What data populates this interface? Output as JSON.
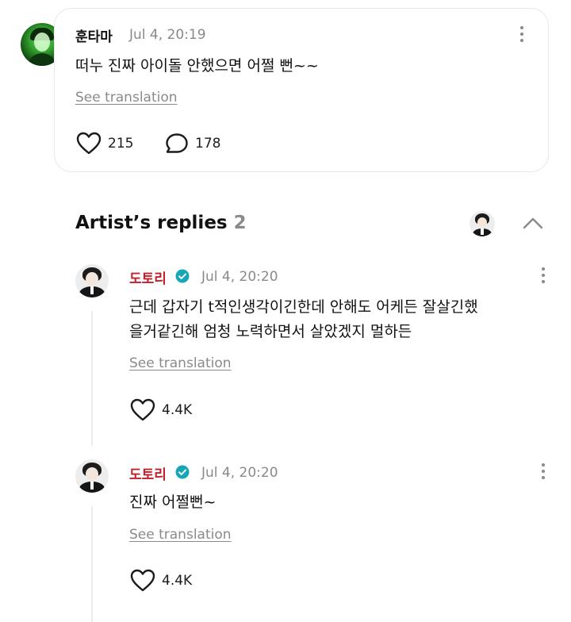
{
  "comment": {
    "author": "훈타마",
    "date": "Jul 4, 20:19",
    "text": "떠누 진짜 아이돌 안했으면 어쩔 뻔~~",
    "see_translation": "See translation",
    "likes": "215",
    "replies": "178"
  },
  "artist_replies": {
    "title": "Artist’s replies",
    "count": "2",
    "collapse_icon": "chevron-up-icon",
    "items": [
      {
        "author": "도토리",
        "date": "Jul 4, 20:20",
        "text": "근데 갑자기 t적인생각이긴한데 안해도 어케든 잘살긴했\n을거같긴해 엄청 노력하면서 살았겠지 멀하든",
        "see_translation": "See translation",
        "likes": "4.4K"
      },
      {
        "author": "도토리",
        "date": "Jul 4, 20:20",
        "text": "진짜 어쩔뻔~",
        "see_translation": "See translation",
        "likes": "4.4K"
      }
    ]
  },
  "colors": {
    "artist_name": "#c3202b",
    "verified_badge": "#16a6b6",
    "muted_text": "#8a8a8a"
  }
}
